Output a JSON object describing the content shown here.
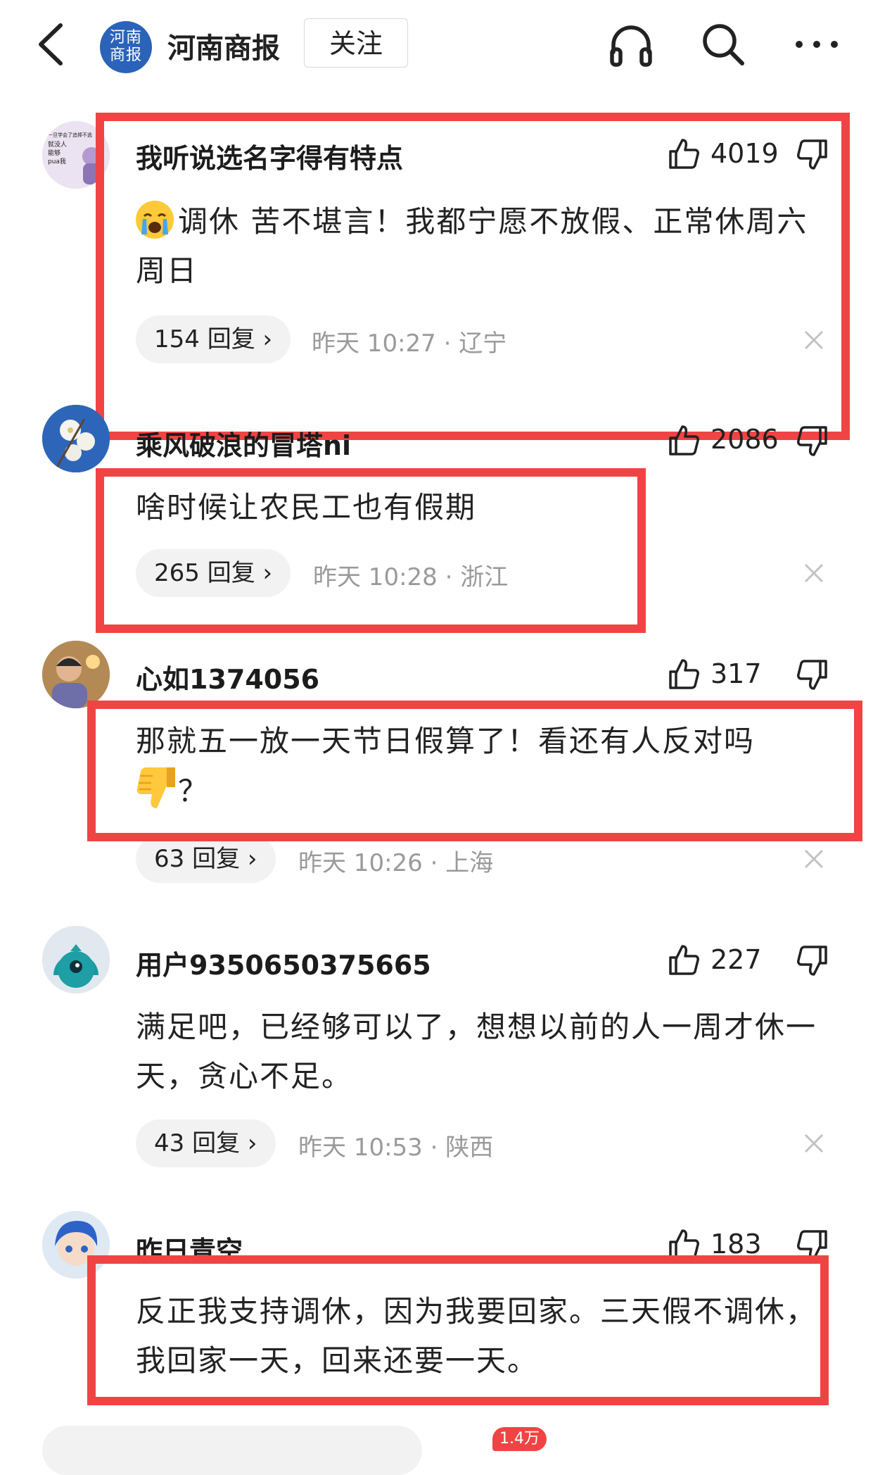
{
  "header": {
    "back_icon": "chevron-left-icon",
    "logo_text": "河南\n商报",
    "paper_name": "河南商报",
    "follow_label": "关注",
    "icons": [
      "headphones-icon",
      "search-icon",
      "more-icon"
    ]
  },
  "comments": [
    {
      "username": "我听说选名字得有特点",
      "avatar_text": "一旦学会了追捧不逃 就没人能够pua我",
      "likes": "4019",
      "text": "调休 苦不堪言！我都宁愿不放假、正常休周六周日",
      "text_emoji": "crying-face-emoji",
      "replies": "154 回复",
      "meta": "昨天 10:27 · 辽宁"
    },
    {
      "username": "乘风破浪的冒塔ni",
      "likes": "2086",
      "text": "啥时候让农民工也有假期",
      "replies": "265 回复",
      "meta": "昨天 10:28 · 浙江"
    },
    {
      "username": "心如1374056",
      "likes": "317",
      "text": "那就五一放一天节日假算了！看还有人反对吗",
      "text_suffix": "？",
      "text_emoji": "thumbs-down-emoji",
      "replies": "63 回复",
      "meta": "昨天 10:26 · 上海"
    },
    {
      "username": "用户9350650375665",
      "likes": "227",
      "text": "满足吧，已经够可以了，想想以前的人一周才休一天，贪心不足。",
      "replies": "43 回复",
      "meta": "昨天 10:53 · 陕西"
    },
    {
      "username": "昨日青空",
      "likes": "183",
      "text": "反正我支持调休，因为我要回家。三天假不调休，我回家一天，回来还要一天。"
    }
  ],
  "bottom_bar": {
    "comment_count_badge": "1.4万"
  },
  "colors": {
    "highlight_box": "#f04444",
    "logo_blue": "#2a63b8",
    "meta_gray": "#9a9a9a",
    "pill_bg": "#f2f2f2"
  }
}
